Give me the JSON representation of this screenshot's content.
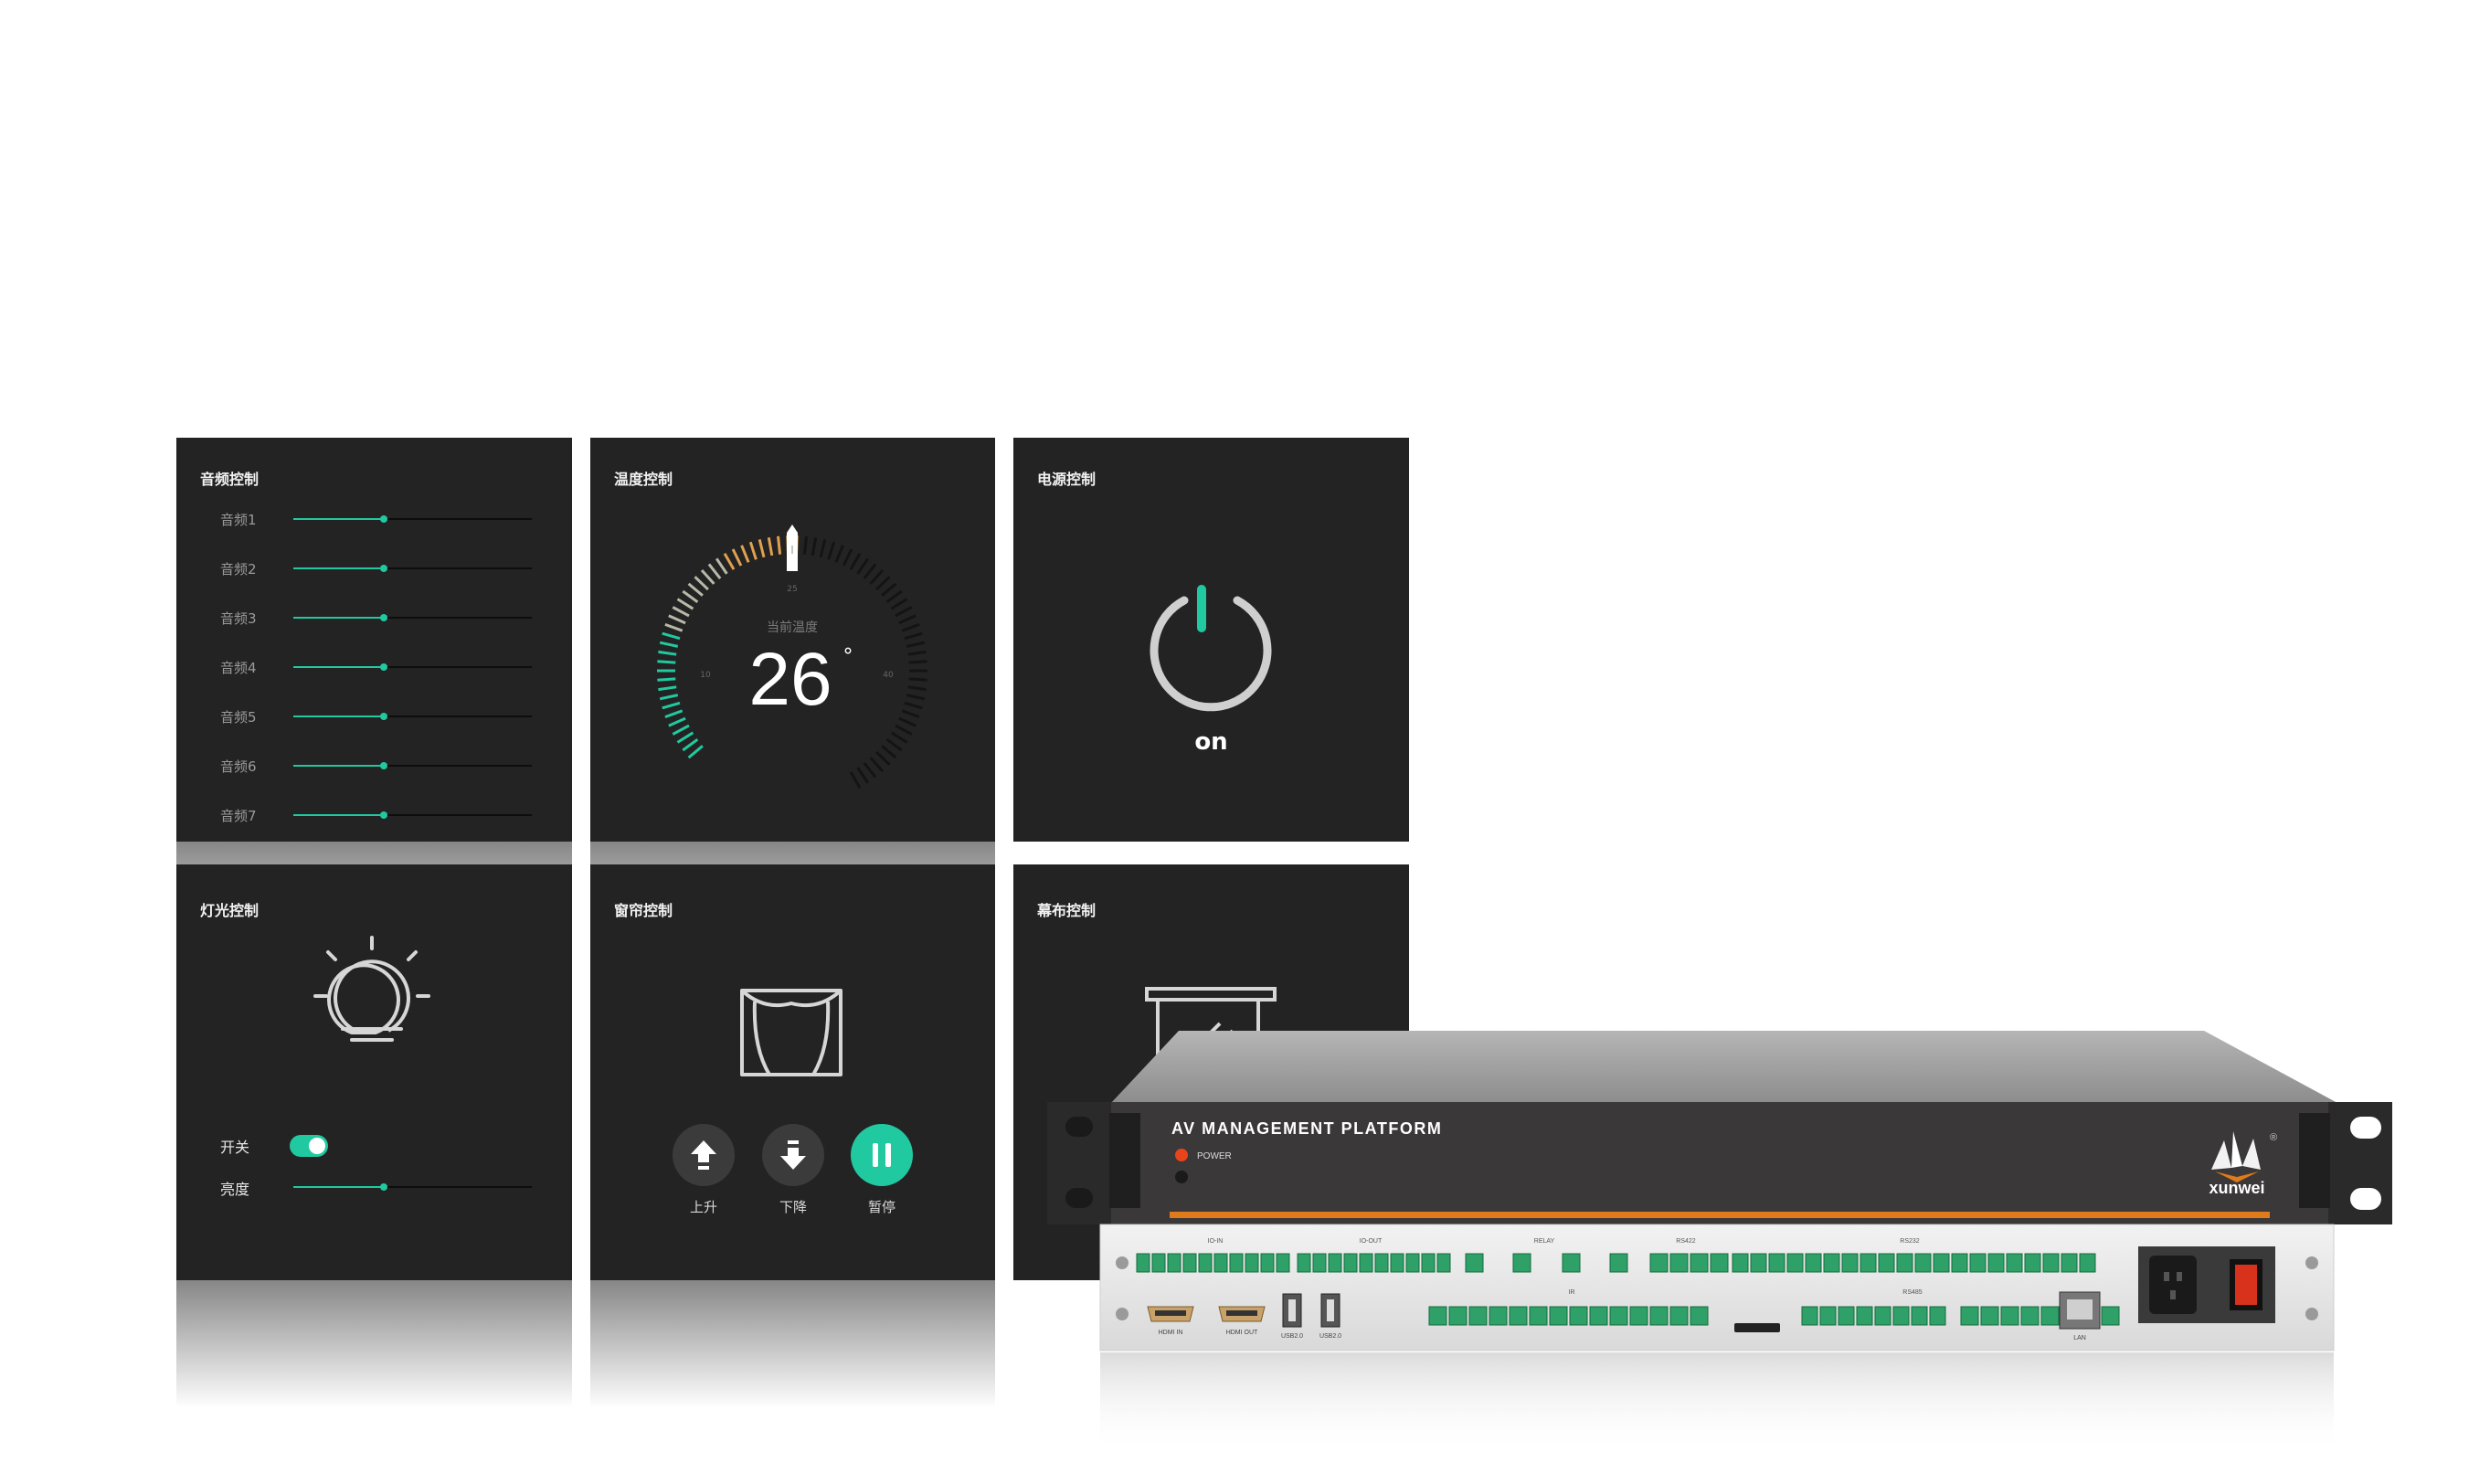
{
  "panels": {
    "audio": {
      "title": "音频控制",
      "channels": [
        {
          "label": "音频1",
          "level": 0.38
        },
        {
          "label": "音频2",
          "level": 0.38
        },
        {
          "label": "音频3",
          "level": 0.38
        },
        {
          "label": "音频4",
          "level": 0.38
        },
        {
          "label": "音频5",
          "level": 0.38
        },
        {
          "label": "音频6",
          "level": 0.38
        },
        {
          "label": "音频7",
          "level": 0.38
        }
      ]
    },
    "temperature": {
      "title": "温度控制",
      "caption": "当前温度",
      "value": "26",
      "unit": "°",
      "current": 26,
      "min_label": "10",
      "mid_label": "25",
      "max_label": "40",
      "active_color": "#21c9a0",
      "warm_color": "#e0a050"
    },
    "power": {
      "title": "电源控制",
      "state": "on",
      "accent": "#21c9a0"
    },
    "lighting": {
      "title": "灯光控制",
      "switch_label": "开关",
      "switch_on": true,
      "brightness_label": "亮度",
      "brightness": 0.38
    },
    "curtain": {
      "title": "窗帘控制",
      "up_label": "上升",
      "down_label": "下降",
      "pause_label": "暂停"
    },
    "screen": {
      "title": "幕布控制"
    }
  },
  "device": {
    "title": "AV MANAGEMENT PLATFORM",
    "power_label": "POWER",
    "brand": "xunwei",
    "registered": "®",
    "rear": {
      "io_in": "IO-IN",
      "io_out": "IO-OUT",
      "relay": "RELAY",
      "rs422": "RS422",
      "rs232": "RS232",
      "rs485": "RS485",
      "ir": "IR",
      "hdmi_in": "HDMI IN",
      "hdmi_out": "HDMI OUT",
      "usb1": "USB2.0",
      "usb2": "USB2.0",
      "lan": "LAN"
    },
    "power_led_color": "#e8441c",
    "stripe_color": "#e07a1a"
  }
}
